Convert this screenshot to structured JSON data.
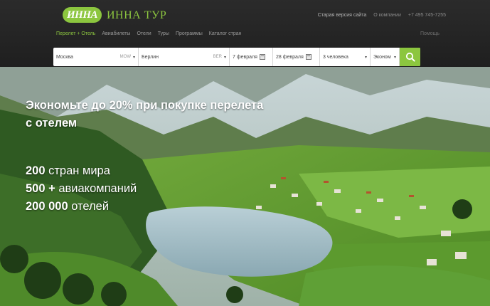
{
  "brand": {
    "logo_badge": "ИННА",
    "name": "ИННА ТУР",
    "accent_color": "#8cc63f"
  },
  "top_links": [
    "Старая версия сайта",
    "О компании",
    "+7 495 745-7255"
  ],
  "nav": {
    "items": [
      "Перелет + Отель",
      "Авиабилеты",
      "Отели",
      "Туры",
      "Программы",
      "Каталог стран"
    ],
    "active_index": 0,
    "help": "Помощь"
  },
  "search": {
    "from_city": "Москва",
    "from_code": "MOW",
    "to_city": "Берлин",
    "to_code": "BER",
    "date_from": "7 февраля",
    "date_to": "28 февраля",
    "travelers": "3 человека",
    "class": "Эконом",
    "icons": {
      "calendar": "calendar-icon",
      "search": "search-icon"
    }
  },
  "hero": {
    "headline": "Экономьте до 20% при покупке перелета с отелем",
    "stats": [
      {
        "value": "200",
        "label": " стран мира"
      },
      {
        "value": "500 +",
        "label": " авиакомпаний"
      },
      {
        "value": "200 000",
        "label": " отелей"
      }
    ]
  }
}
